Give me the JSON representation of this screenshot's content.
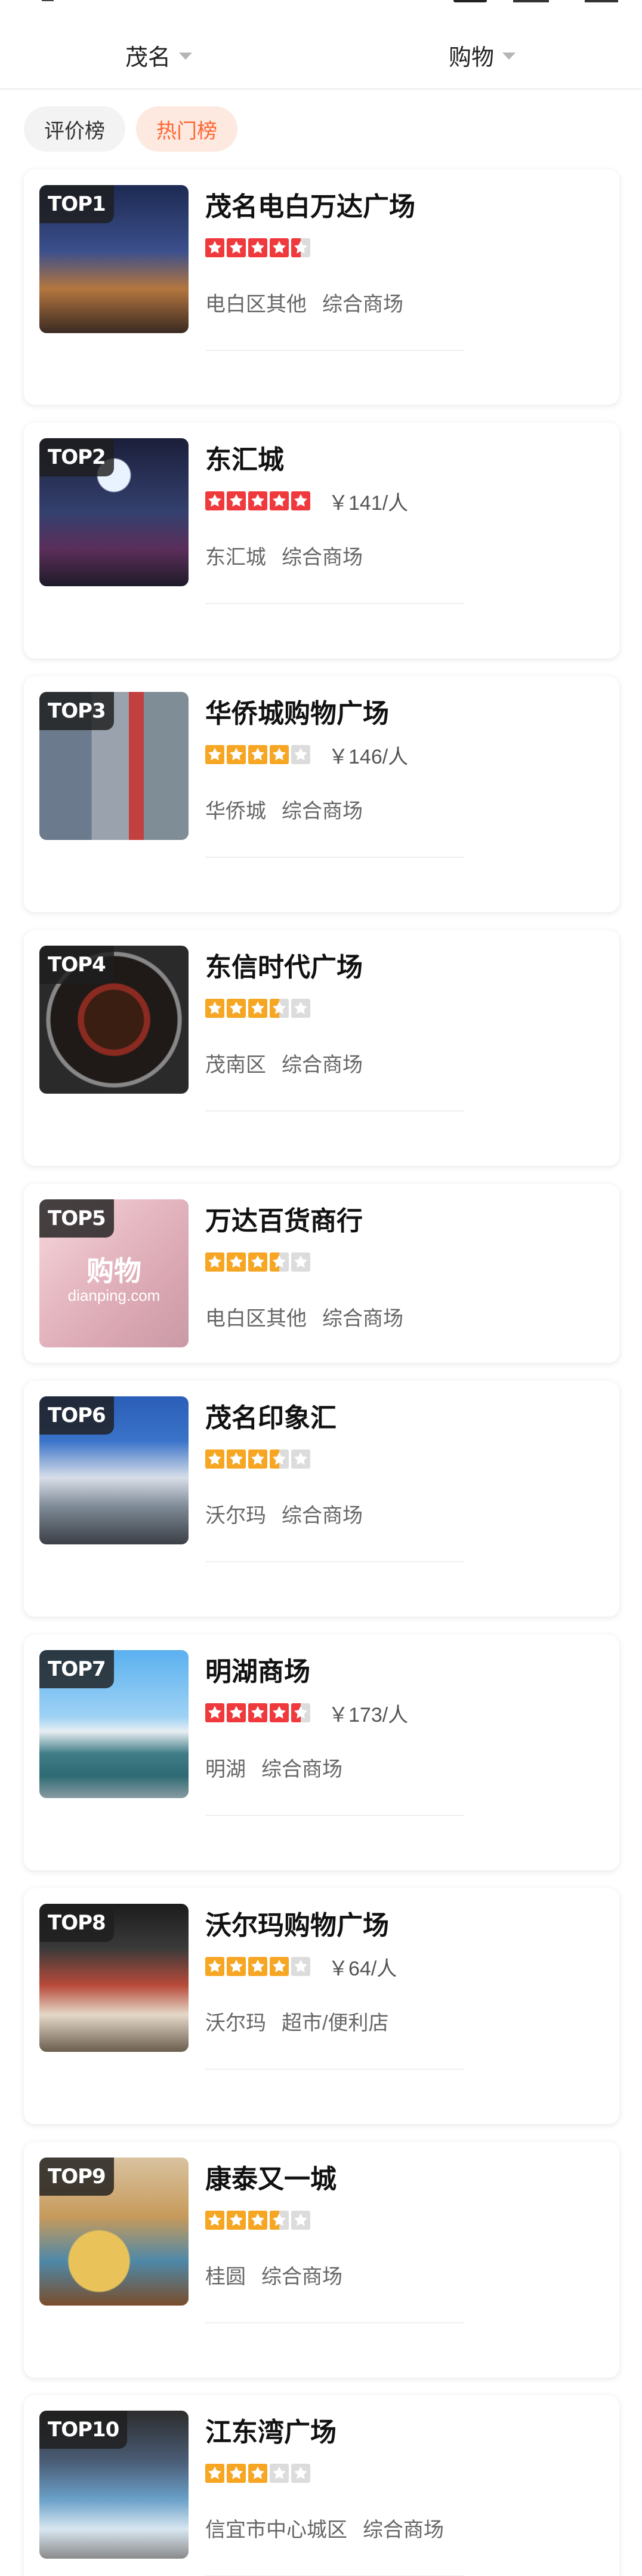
{
  "filters": {
    "city": "茂名",
    "category": "购物"
  },
  "tabs": [
    {
      "label": "评价榜",
      "active": false
    },
    {
      "label": "热门榜",
      "active": true
    }
  ],
  "colors": {
    "accent": "#ff6633",
    "star_red": "#f0393c",
    "star_orange": "#f6a623",
    "star_empty": "#dcdcdc"
  },
  "list": [
    {
      "rank": "TOP1",
      "name": "茂名电白万达广场",
      "rating": 4.5,
      "star_color": "red",
      "price": "",
      "area": "电白区其他",
      "category": "综合商场"
    },
    {
      "rank": "TOP2",
      "name": "东汇城",
      "rating": 5,
      "star_color": "red",
      "price": "￥141/人",
      "area": "东汇城",
      "category": "综合商场"
    },
    {
      "rank": "TOP3",
      "name": "华侨城购物广场",
      "rating": 4,
      "star_color": "orange",
      "price": "￥146/人",
      "area": "华侨城",
      "category": "综合商场"
    },
    {
      "rank": "TOP4",
      "name": "东信时代广场",
      "rating": 3.5,
      "star_color": "orange",
      "price": "",
      "area": "茂南区",
      "category": "综合商场"
    },
    {
      "rank": "TOP5",
      "name": "万达百货商行",
      "rating": 3.5,
      "star_color": "orange",
      "price": "",
      "area": "电白区其他",
      "category": "综合商场"
    },
    {
      "rank": "TOP6",
      "name": "茂名印象汇",
      "rating": 3.5,
      "star_color": "orange",
      "price": "",
      "area": "沃尔玛",
      "category": "综合商场"
    },
    {
      "rank": "TOP7",
      "name": "明湖商场",
      "rating": 4.5,
      "star_color": "red",
      "price": "￥173/人",
      "area": "明湖",
      "category": "综合商场"
    },
    {
      "rank": "TOP8",
      "name": "沃尔玛购物广场",
      "rating": 4,
      "star_color": "orange",
      "price": "￥64/人",
      "area": "沃尔玛",
      "category": "超市/便利店"
    },
    {
      "rank": "TOP9",
      "name": "康泰又一城",
      "rating": 3.5,
      "star_color": "orange",
      "price": "",
      "area": "桂圆",
      "category": "综合商场"
    },
    {
      "rank": "TOP10",
      "name": "江东湾广场",
      "rating": 3,
      "star_color": "orange",
      "price": "",
      "area": "信宜市中心城区",
      "category": "综合商场"
    }
  ],
  "placeholder_image": {
    "label": "购物",
    "watermark": "dianping.com"
  }
}
